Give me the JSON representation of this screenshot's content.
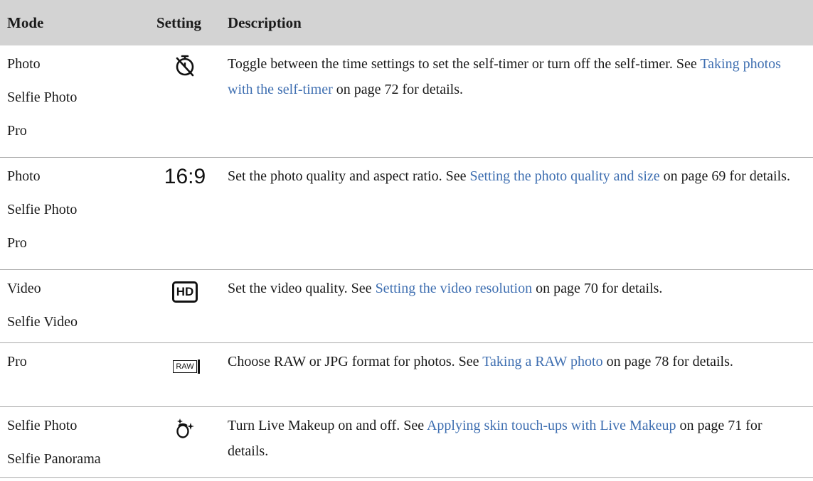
{
  "header": {
    "mode": "Mode",
    "setting": "Setting",
    "description": "Description"
  },
  "rows": [
    {
      "modes": [
        "Photo",
        "Selfie Photo",
        "Pro"
      ],
      "icon": "self-timer-icon",
      "desc_before": "Toggle between the time settings to set the self-timer or turn off the self-timer. See ",
      "link": "Taking photos with the self-timer",
      "desc_after": " on page 72 for details."
    },
    {
      "modes": [
        "Photo",
        "Selfie Photo",
        "Pro"
      ],
      "icon": "aspect-ratio-icon",
      "icon_text": "16:9",
      "desc_before": "Set the photo quality and aspect ratio. See ",
      "link": "Setting the photo quality and size",
      "desc_after": " on page 69 for details."
    },
    {
      "modes": [
        "Video",
        "Selfie Video"
      ],
      "icon": "hd-video-icon",
      "icon_text": "HD",
      "desc_before": "Set the video quality. See ",
      "link": "Setting the video resolution",
      "desc_after": " on page 70 for details."
    },
    {
      "modes": [
        "Pro"
      ],
      "icon": "raw-format-icon",
      "icon_text": "RAW",
      "desc_before": "Choose RAW or JPG format for photos. See ",
      "link": "Taking a RAW photo",
      "desc_after": " on page 78 for details."
    },
    {
      "modes": [
        "Selfie Photo",
        "Selfie Panorama"
      ],
      "icon": "live-makeup-icon",
      "desc_before": "Turn Live Makeup on and off. See ",
      "link": "Applying skin touch-ups with Live Makeup",
      "desc_after": " on page 71 for details."
    }
  ],
  "colors": {
    "header_bg": "#d3d3d3",
    "link": "#3f6fb1",
    "rule": "#a9a9a9"
  }
}
